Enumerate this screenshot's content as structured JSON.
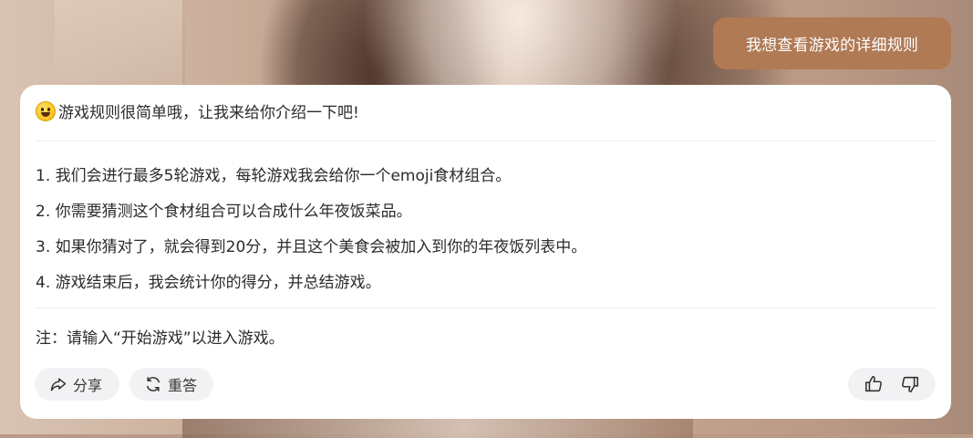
{
  "user_message": "我想查看游戏的详细规则",
  "reply": {
    "intro": "游戏规则很简单哦，让我来给你介绍一下吧!",
    "rules": [
      "1. 我们会进行最多5轮游戏，每轮游戏我会给你一个emoji食材组合。",
      "2. 你需要猜测这个食材组合可以合成什么年夜饭菜品。",
      "3. 如果你猜对了，就会得到20分，并且这个美食会被加入到你的年夜饭列表中。",
      "4. 游戏结束后，我会统计你的得分，并总结游戏。"
    ],
    "note": "注：请输入“开始游戏”以进入游戏。"
  },
  "actions": {
    "share_label": "分享",
    "regenerate_label": "重答"
  },
  "icons": {
    "intro_emoji": "grinning-face-emoji",
    "share": "share-icon",
    "regenerate": "refresh-icon",
    "like": "thumbs-up-icon",
    "dislike": "thumbs-down-icon"
  },
  "colors": {
    "user_bubble": "#b07a55",
    "card_background": "#ffffff",
    "button_background": "#f2f2f4",
    "text": "#2b2b2b"
  }
}
